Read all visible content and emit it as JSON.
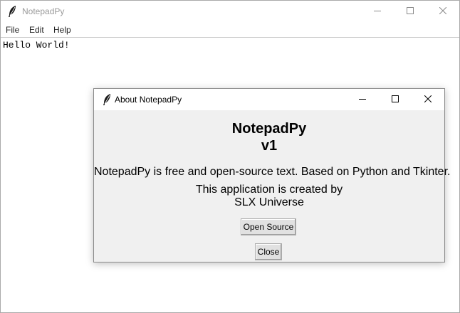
{
  "main_window": {
    "title": "NotepadPy",
    "menu": [
      "File",
      "Edit",
      "Help"
    ],
    "editor_text": "Hello World!"
  },
  "about_dialog": {
    "title": "About NotepadPy",
    "app_name": "NotepadPy",
    "version": "v1",
    "description": "NotepadPy is free and open-source text. Based on Python and Tkinter.",
    "credits_line1": "This application is created by",
    "credits_line2": "SLX Universe",
    "open_source_button": "Open Source",
    "close_button": "Close"
  },
  "icons": {
    "app": "feather-icon",
    "minimize": "minimize-icon",
    "maximize": "maximize-icon",
    "close": "close-icon"
  }
}
